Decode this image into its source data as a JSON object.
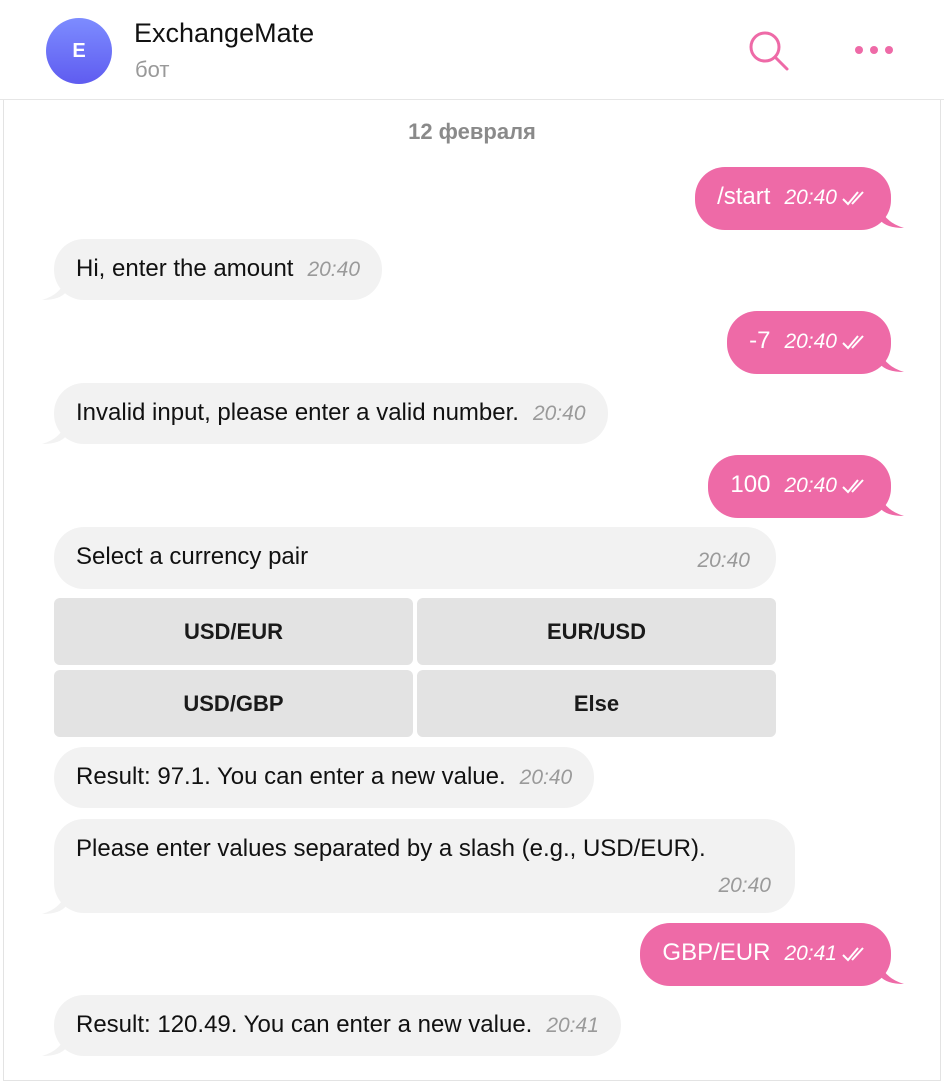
{
  "header": {
    "avatar_letter": "E",
    "title": "ExchangeMate",
    "subtitle": "бот",
    "search_icon": "search-icon",
    "more_icon": "more-dots-icon"
  },
  "date_separator": "12 февраля",
  "messages": [
    {
      "dir": "out",
      "text": "/start",
      "time": "20:40"
    },
    {
      "dir": "in",
      "text": "Hi, enter the amount",
      "time": "20:40"
    },
    {
      "dir": "out",
      "text": "-7",
      "time": "20:40"
    },
    {
      "dir": "in",
      "text": "Invalid input, please enter a valid number.",
      "time": "20:40"
    },
    {
      "dir": "out",
      "text": "100",
      "time": "20:40"
    },
    {
      "dir": "in",
      "text": "Select a currency pair",
      "time": "20:40"
    },
    {
      "dir": "in",
      "text": "Result: 97.1. You can enter a new value.",
      "time": "20:40"
    },
    {
      "dir": "in",
      "text": "Please enter values separated by a slash (e.g., USD/EUR).",
      "time": "20:40"
    },
    {
      "dir": "out",
      "text": "GBP/EUR",
      "time": "20:41"
    },
    {
      "dir": "in",
      "text": "Result: 120.49. You can enter a new value.",
      "time": "20:41"
    }
  ],
  "keyboard": {
    "buttons": [
      "USD/EUR",
      "EUR/USD",
      "USD/GBP",
      "Else"
    ]
  },
  "colors": {
    "accent": "#ee6aa7",
    "incoming_bubble": "#f2f2f2",
    "keyboard_button": "#e3e3e3"
  }
}
